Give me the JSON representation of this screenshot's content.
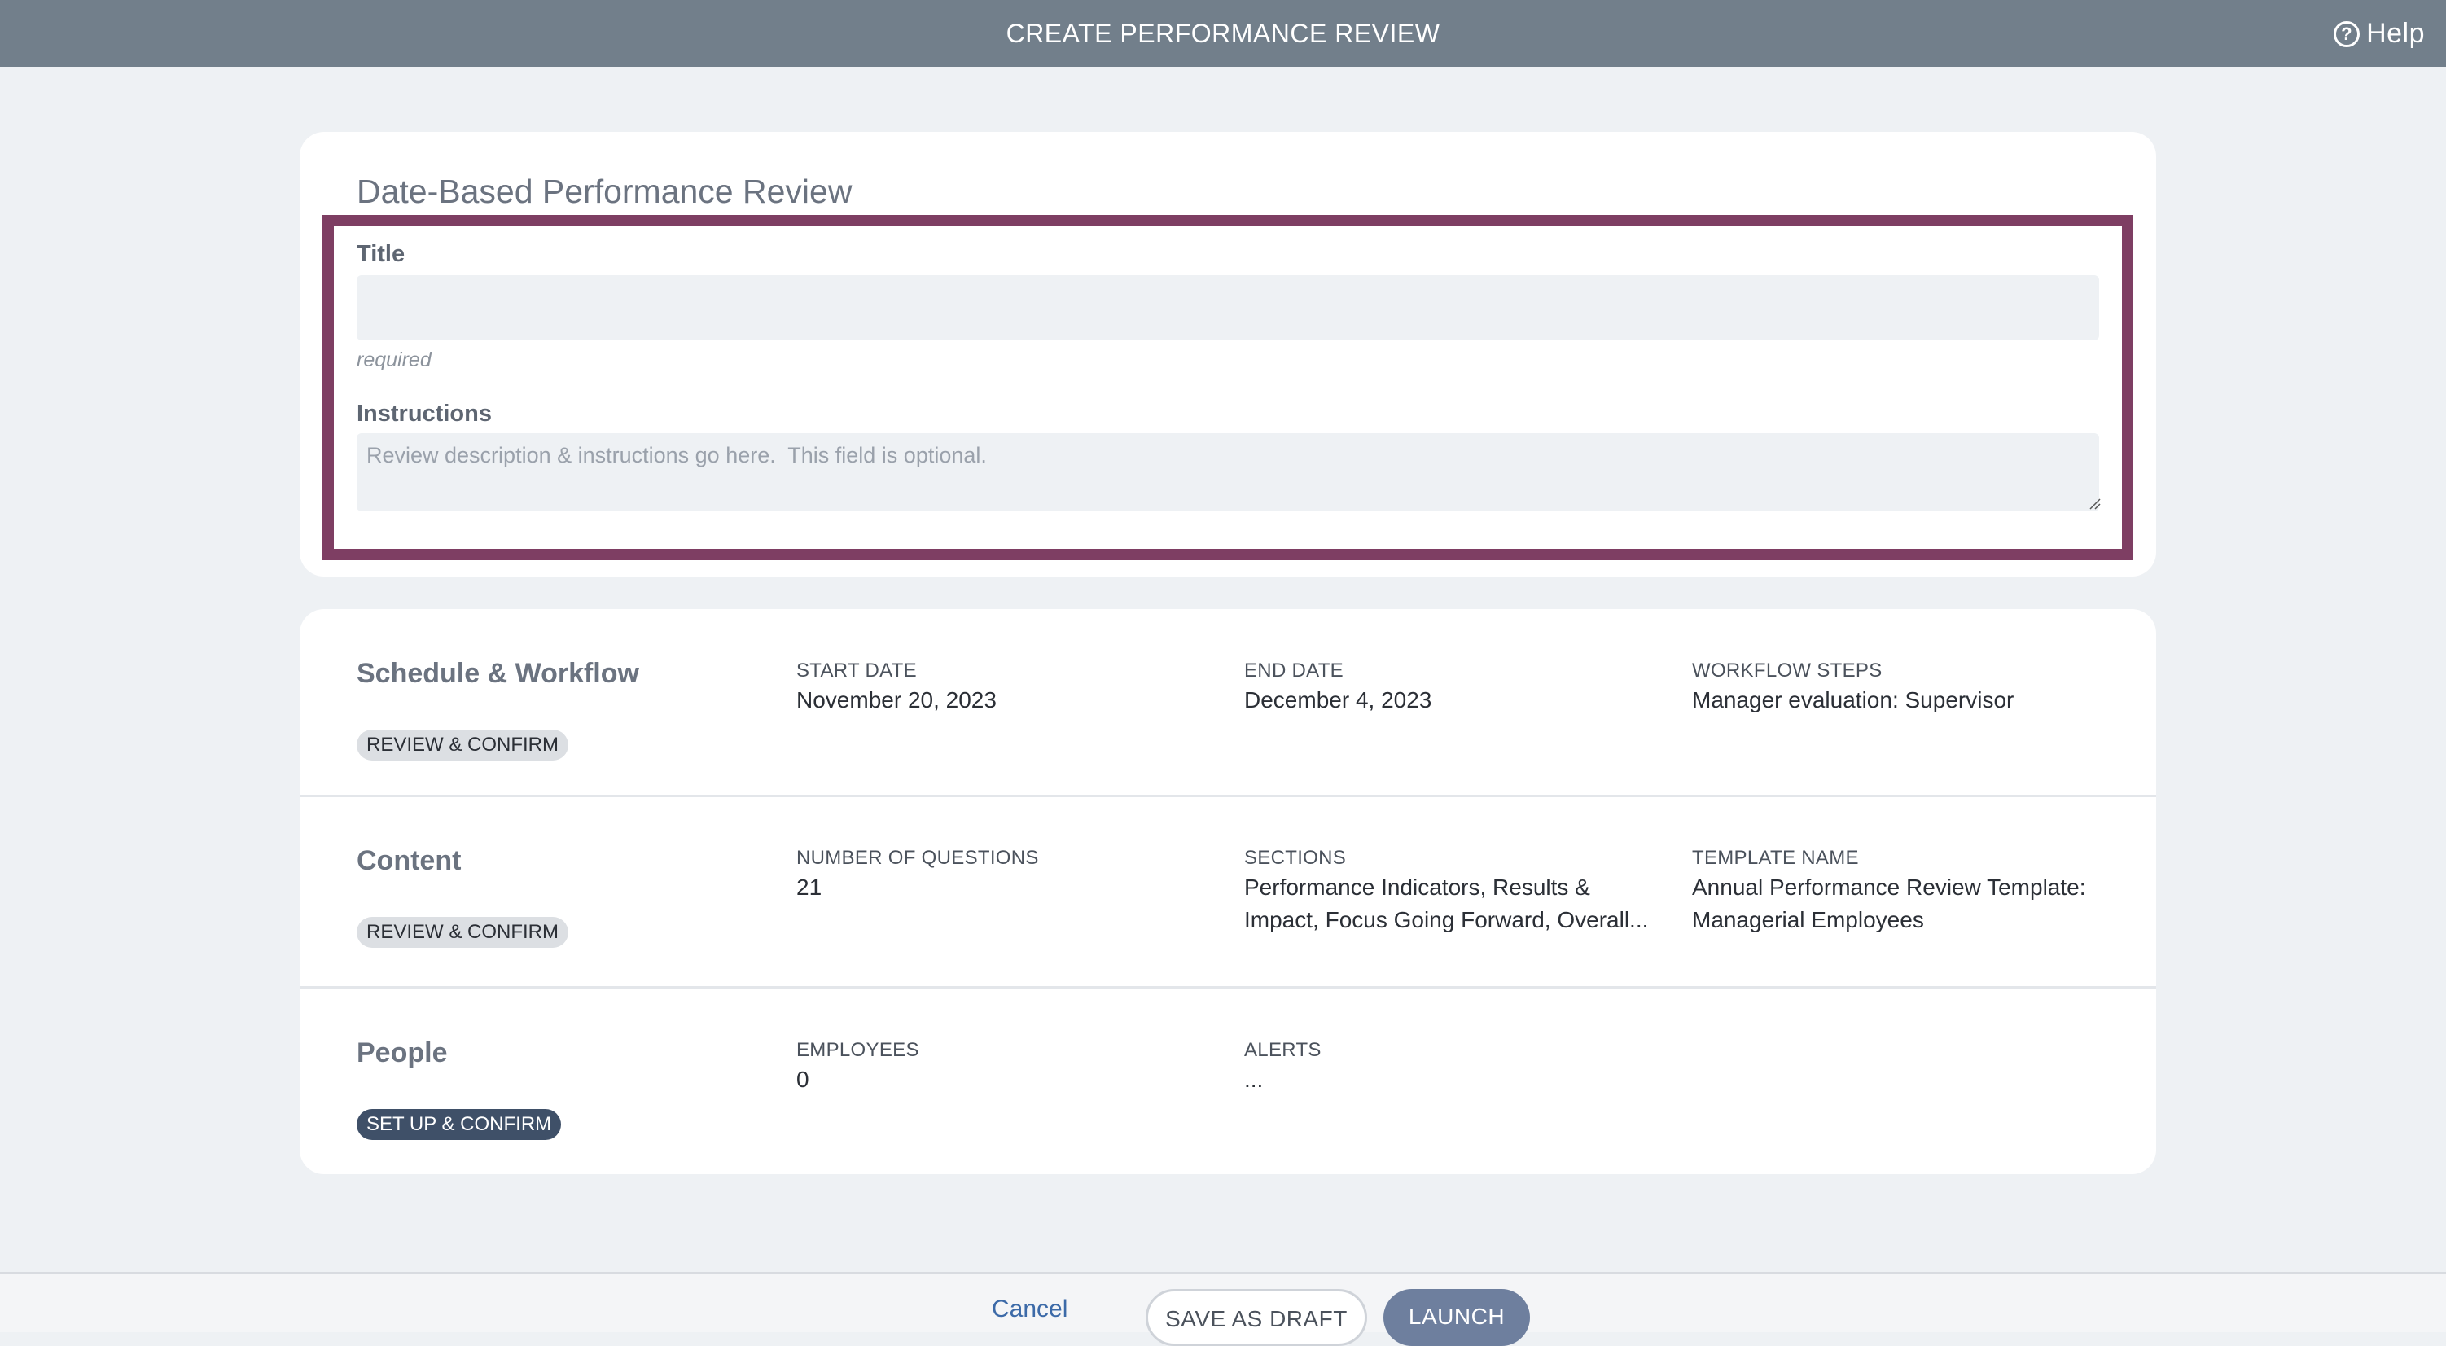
{
  "header": {
    "title": "CREATE PERFORMANCE REVIEW",
    "help_label": "Help"
  },
  "form": {
    "heading": "Date-Based Performance Review",
    "title_label": "Title",
    "title_value": "",
    "title_hint": "required",
    "instructions_label": "Instructions",
    "instructions_placeholder": "Review description & instructions go here.  This field is optional."
  },
  "sections": {
    "schedule": {
      "title": "Schedule & Workflow",
      "action": "REVIEW & CONFIRM",
      "start_label": "START DATE",
      "start_value": "November 20, 2023",
      "end_label": "END DATE",
      "end_value": "December 4, 2023",
      "workflow_label": "WORKFLOW STEPS",
      "workflow_value": "Manager evaluation: Supervisor"
    },
    "content": {
      "title": "Content",
      "action": "REVIEW & CONFIRM",
      "questions_label": "NUMBER OF QUESTIONS",
      "questions_value": "21",
      "sections_label": "SECTIONS",
      "sections_value_line1": "Performance Indicators, Results &",
      "sections_value_line2": "Impact, Focus Going Forward, Overall...",
      "template_label": "TEMPLATE NAME",
      "template_value_line1": "Annual Performance Review Template:",
      "template_value_line2": "Managerial Employees"
    },
    "people": {
      "title": "People",
      "action": "SET UP & CONFIRM",
      "employees_label": "EMPLOYEES",
      "employees_value": "0",
      "alerts_label": "ALERTS",
      "alerts_value": "..."
    }
  },
  "footer": {
    "cancel_label": "Cancel",
    "draft_label": "SAVE AS DRAFT",
    "launch_label": "LAUNCH"
  },
  "colors": {
    "header_bg": "#727f8b",
    "highlight_border": "#7e3e63",
    "launch_button": "#6e7f9e",
    "setup_pill": "#3f5068"
  }
}
